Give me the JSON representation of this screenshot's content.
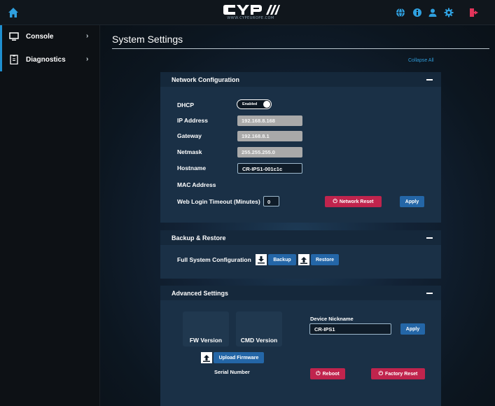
{
  "app": {
    "logo_text": "CYP",
    "logo_sub": "WWW.CYPEUROPE.COM",
    "colors": {
      "accent": "#1f8fd0",
      "danger": "#c0244d",
      "primary_button": "#2466a7"
    }
  },
  "topbar": {
    "icons": [
      "home-icon",
      "globe-icon",
      "info-icon",
      "user-icon",
      "gear-icon",
      "logout-icon"
    ]
  },
  "sidebar": {
    "items": [
      {
        "label": "Console",
        "icon": "monitor-icon"
      },
      {
        "label": "Diagnostics",
        "icon": "clipboard-icon"
      }
    ]
  },
  "main": {
    "title": "System Settings",
    "collapse_all": "Collapse All"
  },
  "network": {
    "title": "Network Configuration",
    "dhcp_label": "DHCP",
    "dhcp_state": "Enabled",
    "ip_label": "IP Address",
    "ip_value": "192.168.8.168",
    "gateway_label": "Gateway",
    "gateway_value": "192.168.8.1",
    "netmask_label": "Netmask",
    "netmask_value": "255.255.255.0",
    "hostname_label": "Hostname",
    "hostname_value": "CR-IPS1-001c1c",
    "mac_label": "MAC Address",
    "timeout_label": "Web Login Timeout (Minutes)",
    "timeout_value": "0",
    "reset_label": "Network Reset",
    "apply_label": "Apply"
  },
  "backup": {
    "title": "Backup & Restore",
    "full_label": "Full System Configuration",
    "backup_label": "Backup",
    "restore_label": "Restore"
  },
  "advanced": {
    "title": "Advanced Settings",
    "fw_label": "FW Version",
    "cmd_label": "CMD Version",
    "upload_label": "Upload Firmware",
    "serial_label": "Serial Number",
    "nickname_label": "Device Nickname",
    "nickname_value": "CR-IPS1",
    "apply_label": "Apply",
    "reboot_label": "Reboot",
    "factory_label": "Factory Reset"
  }
}
